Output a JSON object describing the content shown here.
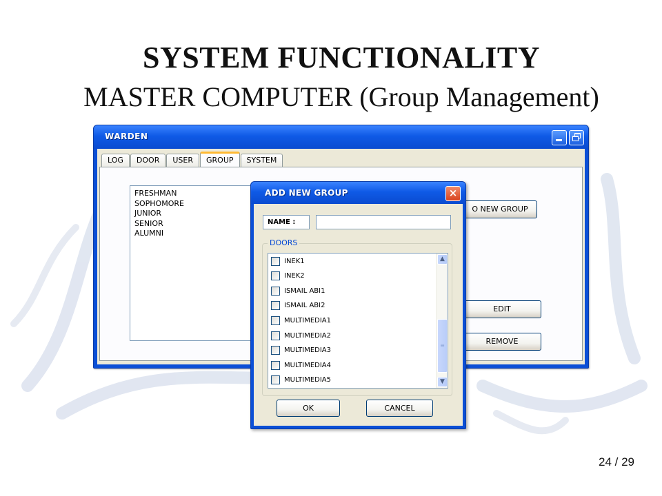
{
  "slide": {
    "title": "SYSTEM FUNCTIONALITY",
    "subtitle": "MASTER COMPUTER (Group Management)",
    "page_number": "24 / 29"
  },
  "main_window": {
    "title": "WARDEN",
    "tabs": [
      {
        "label": "LOG",
        "active": false
      },
      {
        "label": "DOOR",
        "active": false
      },
      {
        "label": "USER",
        "active": false
      },
      {
        "label": "GROUP",
        "active": true
      },
      {
        "label": "SYSTEM",
        "active": false
      }
    ],
    "groups": [
      "FRESHMAN",
      "SOPHOMORE",
      "JUNIOR",
      "SENIOR",
      "ALUMNI"
    ],
    "buttons": {
      "add": "O NEW GROUP",
      "edit": "EDIT",
      "remove": "REMOVE"
    }
  },
  "dialog": {
    "title": "ADD NEW GROUP",
    "close_label": "×",
    "name_label": "NAME  :",
    "name_value": "",
    "doors_legend": "DOORS",
    "doors": [
      {
        "label": "INEK1",
        "checked": false
      },
      {
        "label": "INEK2",
        "checked": false
      },
      {
        "label": "ISMAIL ABI1",
        "checked": false
      },
      {
        "label": "ISMAIL ABI2",
        "checked": false
      },
      {
        "label": "MULTIMEDIA1",
        "checked": false
      },
      {
        "label": "MULTIMEDIA2",
        "checked": false
      },
      {
        "label": "MULTIMEDIA3",
        "checked": false
      },
      {
        "label": "MULTIMEDIA4",
        "checked": false
      },
      {
        "label": "MULTIMEDIA5",
        "checked": false
      }
    ],
    "ok_label": "OK",
    "cancel_label": "CANCEL"
  },
  "colors": {
    "titlebar_blue": "#0f5ae6",
    "window_bg": "#ece9d8",
    "close_red": "#d9431e",
    "active_tab_accent": "#ffb932",
    "legend_blue": "#0046d5"
  }
}
